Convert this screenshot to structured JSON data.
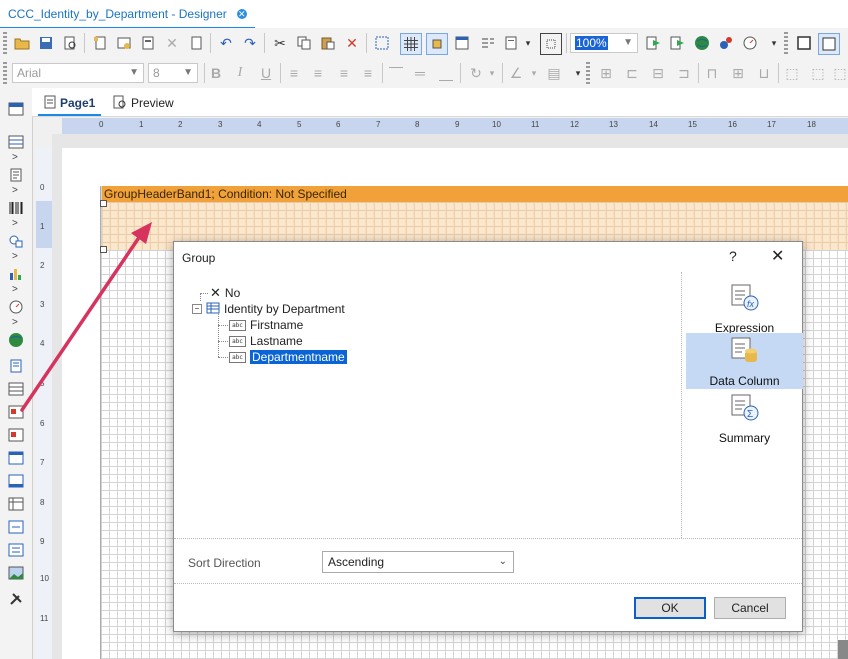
{
  "document_tab": {
    "title": "CCC_Identity_by_Department - Designer",
    "close_icon": "close-circle-icon"
  },
  "toolbar": {
    "font_name": "Arial",
    "font_size": "8",
    "zoom": "100%",
    "bold": "B",
    "italic": "I",
    "underline": "U"
  },
  "page_tabs": {
    "page1": "Page1",
    "preview": "Preview"
  },
  "ruler_top": [
    "0",
    "1",
    "2",
    "3",
    "4",
    "5",
    "6",
    "7",
    "8",
    "9",
    "10",
    "11",
    "12",
    "13",
    "14",
    "15",
    "16",
    "17",
    "18"
  ],
  "ruler_left": [
    "0",
    "1",
    "2",
    "3",
    "4",
    "5",
    "6",
    "7",
    "8",
    "9",
    "10",
    "11"
  ],
  "band": {
    "header_text": "GroupHeaderBand1; Condition: Not Specified"
  },
  "dialog": {
    "title": "Group",
    "help": "?",
    "close": "✕",
    "tree": {
      "no_item": "No",
      "datasource": "Identity by Department",
      "columns": [
        "Firstname",
        "Lastname",
        "Departmentname"
      ],
      "selected": "Departmentname"
    },
    "right_pane": {
      "expression": "Expression",
      "data_column": "Data Column",
      "summary": "Summary",
      "active": "Data Column"
    },
    "sort_direction_label": "Sort Direction",
    "sort_direction_value": "Ascending",
    "ok": "OK",
    "cancel": "Cancel"
  },
  "colors": {
    "band_header": "#f0a13a",
    "band_body": "#fbe3c4",
    "selection": "#0a64d6",
    "annotation_arrow": "#d6345f",
    "active_tile": "#c5d9f5"
  }
}
